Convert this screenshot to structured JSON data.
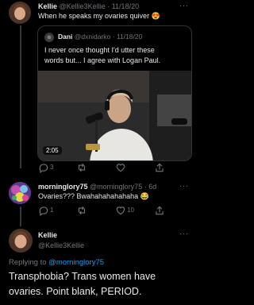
{
  "tweet1": {
    "name": "Kellie",
    "handle": "@Kellie3Kellie",
    "date": "· 11/18/20",
    "text": "When he speaks my ovaries quiver 😍",
    "more": "···",
    "quote": {
      "name": "Dani",
      "handle": "@dxnidarko",
      "date": "· 11/18/20",
      "text_line1": "I never once thought I'd utter these",
      "text_line2": "words but... I agree with Logan Paul.",
      "video_duration": "2:05"
    },
    "replies": "3",
    "retweets": "",
    "likes": ""
  },
  "tweet2": {
    "name": "morninglory75",
    "handle": "@morninglory75",
    "date": "· 6d",
    "text": "Ovaries??? Bwahahahahahaha 😂",
    "more": "···",
    "replies": "1",
    "retweets": "",
    "likes": "10"
  },
  "tweet3": {
    "name": "Kellie",
    "handle": "@Kellie3Kellie",
    "more": "···",
    "replying_prefix": "Replying to ",
    "replying_to": "@morninglory75",
    "text_line1": "Transphobia? Trans women have",
    "text_line2": "ovaries. Point blank, PERIOD."
  },
  "colors": {
    "background": "#000000",
    "text": "#e7e9ea",
    "muted": "#71767b",
    "link": "#1d9bf0"
  }
}
